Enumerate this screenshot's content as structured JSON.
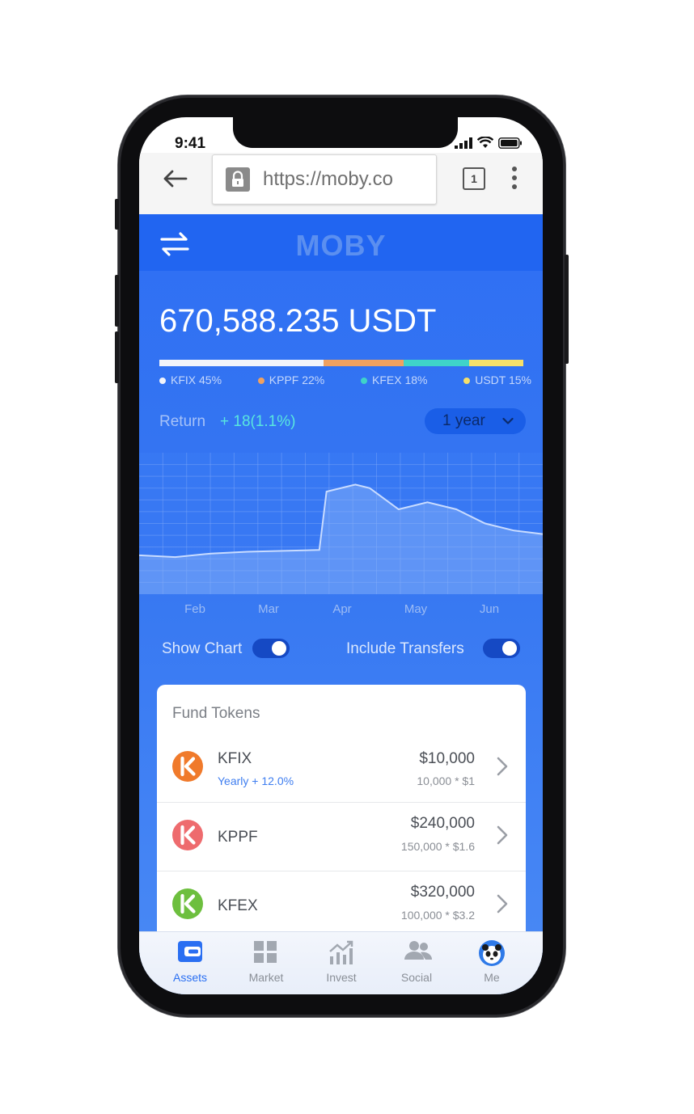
{
  "status": {
    "time": "9:41"
  },
  "browser": {
    "url": "https://moby.co",
    "tab_count": "1"
  },
  "app": {
    "brand": "MOBY"
  },
  "balance": {
    "value": "670,588.235 USDT"
  },
  "allocation": [
    {
      "label": "KFIX 45%",
      "share": 45,
      "color": "#f2f4fa"
    },
    {
      "label": "KPPF 22%",
      "share": 22,
      "color": "#f0a160"
    },
    {
      "label": "KFEX 18%",
      "share": 18,
      "color": "#3fd3c9"
    },
    {
      "label": "USDT 15%",
      "share": 15,
      "color": "#f6e06a"
    }
  ],
  "return": {
    "label": "Return",
    "value": "+ 18(1.1%)",
    "period": "1 year"
  },
  "chart_data": {
    "type": "area",
    "title": "",
    "xlabel": "",
    "ylabel": "",
    "categories": [
      "Feb",
      "Mar",
      "Apr",
      "May",
      "Jun"
    ],
    "grid": true,
    "x": [
      0,
      0.5,
      1,
      1.5,
      2,
      2.5,
      2.6,
      3,
      3.2,
      3.6,
      4,
      4.4,
      4.8,
      5.2,
      5.6
    ],
    "values": [
      22,
      21,
      23,
      24,
      24.5,
      25,
      58,
      62,
      60,
      48,
      52,
      48,
      40,
      36,
      34
    ],
    "ylim": [
      0,
      80
    ]
  },
  "toggles": {
    "show_chart": {
      "label": "Show Chart",
      "on": true
    },
    "include_transfers": {
      "label": "Include Transfers",
      "on": true
    }
  },
  "fund_tokens": {
    "title": "Fund Tokens",
    "items": [
      {
        "name": "KFIX",
        "sub": "Yearly + 12.0%",
        "amount": "$10,000",
        "calc": "10,000 * $1",
        "color": "#f07a2b"
      },
      {
        "name": "KPPF",
        "sub": "",
        "amount": "$240,000",
        "calc": "150,000 * $1.6",
        "color": "#ee6b6e"
      },
      {
        "name": "KFEX",
        "sub": "",
        "amount": "$320,000",
        "calc": "100,000 * $3.2",
        "color": "#6dbf3e"
      }
    ]
  },
  "tabbar": {
    "items": [
      {
        "label": "Assets",
        "active": true
      },
      {
        "label": "Market",
        "active": false
      },
      {
        "label": "Invest",
        "active": false
      },
      {
        "label": "Social",
        "active": false
      },
      {
        "label": "Me",
        "active": false
      }
    ],
    "active_color": "#2a6ff2"
  }
}
